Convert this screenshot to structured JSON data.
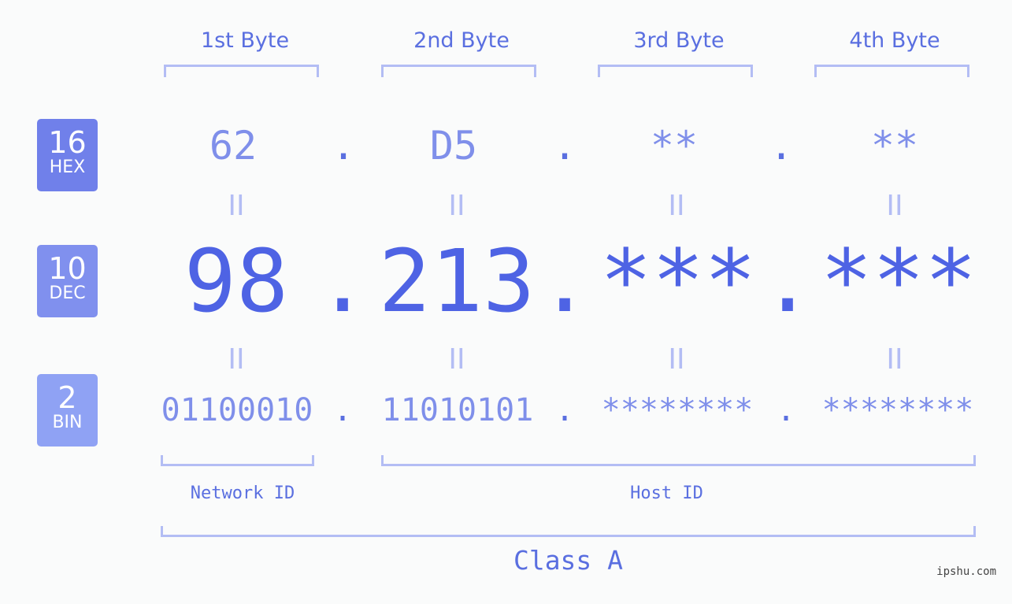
{
  "bytes": [
    {
      "header": "1st Byte",
      "hex": "62",
      "dec": "98",
      "bin": "01100010"
    },
    {
      "header": "2nd Byte",
      "hex": "D5",
      "dec": "213",
      "bin": "11010101"
    },
    {
      "header": "3rd Byte",
      "hex": "**",
      "dec": "***",
      "bin": "********"
    },
    {
      "header": "4th Byte",
      "hex": "**",
      "dec": "***",
      "bin": "********"
    }
  ],
  "separator": ".",
  "equals_symbol": "II",
  "bases": [
    {
      "number": "16",
      "abbr": "HEX",
      "color": "#7080ea"
    },
    {
      "number": "10",
      "abbr": "DEC",
      "color": "#8090ee"
    },
    {
      "number": "2",
      "abbr": "BIN",
      "color": "#8fa2f4"
    }
  ],
  "segments": {
    "network": "Network ID",
    "host": "Host ID",
    "class": "Class A"
  },
  "watermark": "ipshu.com",
  "colors": {
    "primary": "#4e63e4",
    "secondary": "#7f8fea",
    "bracket": "#b3bdf4",
    "background": "#fafbfb"
  }
}
